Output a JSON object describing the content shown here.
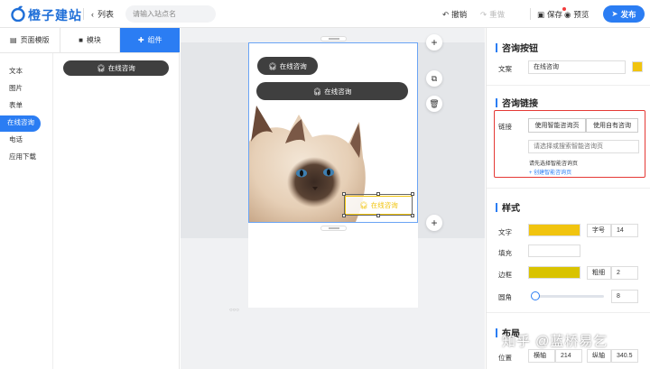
{
  "app": {
    "logo_text": "橙子建站",
    "back_label": "列表",
    "search_placeholder": "请输入站点名"
  },
  "toolbar": {
    "undo": "撤销",
    "redo": "重做",
    "save": "保存",
    "preview": "预览",
    "publish": "发布"
  },
  "left_tabs": [
    {
      "label": "页面模版"
    },
    {
      "label": "模块"
    },
    {
      "label": "组件"
    }
  ],
  "categories": [
    "文本",
    "图片",
    "表单",
    "在线咨询",
    "电话",
    "应用下载"
  ],
  "component_preview": "在线咨询",
  "canvas": {
    "btn_small": "在线咨询",
    "btn_wide": "在线咨询",
    "btn_selected": "在线咨询",
    "footer_dots": "○○○"
  },
  "right": {
    "section1_title": "咨询按钮",
    "copy_label": "文案",
    "copy_value": "在线咨询",
    "section2_title": "咨询链接",
    "link_label": "链接",
    "seg_smart": "使用智能咨询页",
    "seg_own": "使用自有咨询",
    "link_placeholder": "请选择或搜索智能咨询页",
    "link_hint": "请先选择智能咨询页",
    "create_link": "+ 创建智能咨询页",
    "section3_title": "样式",
    "text_label": "文字",
    "font_size_label": "字号",
    "font_size_value": "14",
    "fill_label": "填充",
    "border_label": "边框",
    "border_width_label": "粗细",
    "border_width_value": "2",
    "radius_label": "圆角",
    "radius_value": "8",
    "section4_title": "布局",
    "position_label": "位置",
    "x_label": "横轴",
    "x_value": "214",
    "y_label": "纵轴",
    "y_value": "340.5"
  },
  "colors": {
    "accent": "#2b7df3",
    "yellow": "#f1c40f",
    "dark_button": "#3f3f3f",
    "highlight_red": "#e53935"
  },
  "watermark": "知乎 @蓝桥易乞"
}
